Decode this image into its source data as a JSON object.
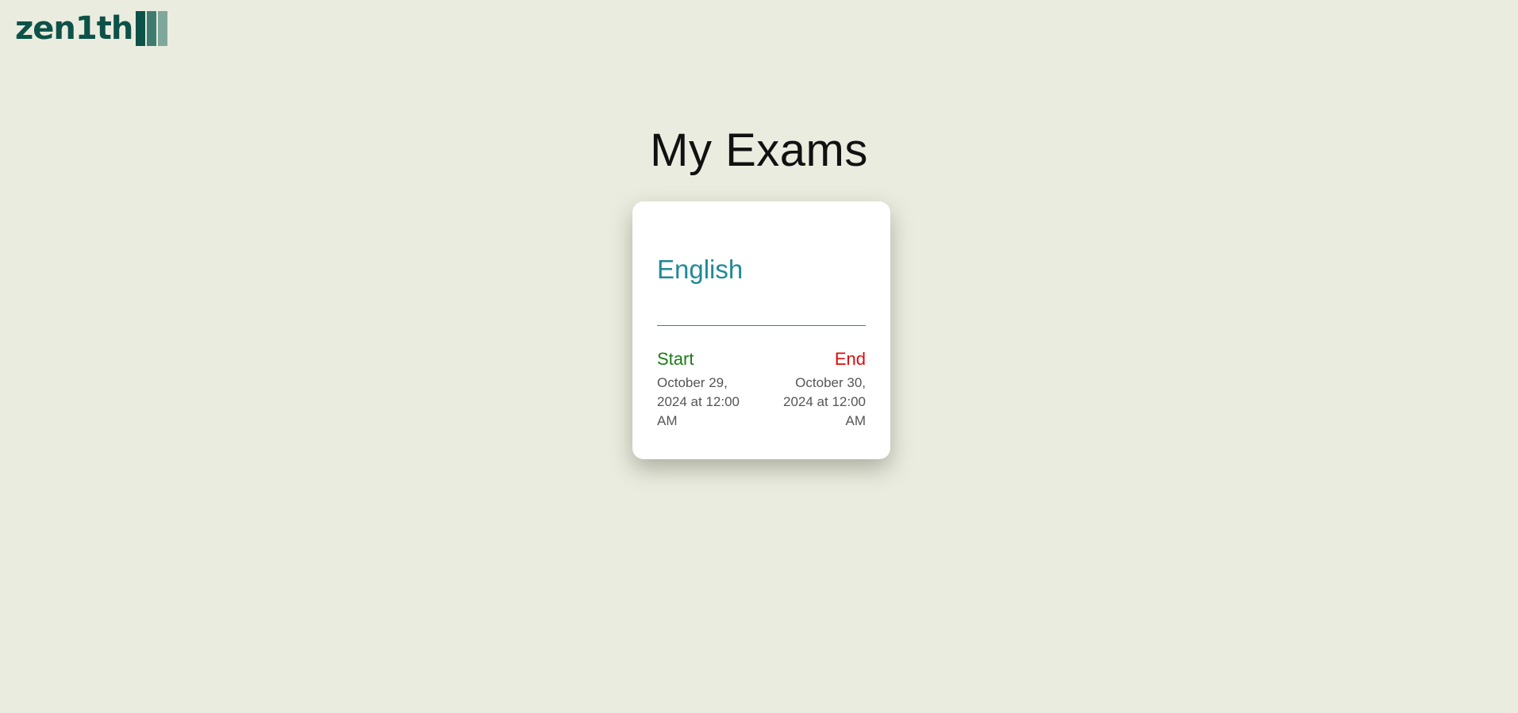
{
  "brand": {
    "logo_text": "zen1th",
    "colors": {
      "primary": "#0d5249",
      "mid": "#3f7c70",
      "light": "#7fa79c"
    }
  },
  "page": {
    "title": "My Exams",
    "background": "#eaecdf"
  },
  "exams": [
    {
      "subject": "English",
      "start_label": "Start",
      "start_value": "October 29, 2024 at 12:00 AM",
      "end_label": "End",
      "end_value": "October 30, 2024 at 12:00 AM",
      "colors": {
        "subject": "#1f8a96",
        "start": "#1b7d16",
        "end": "#d90d0d"
      }
    }
  ]
}
